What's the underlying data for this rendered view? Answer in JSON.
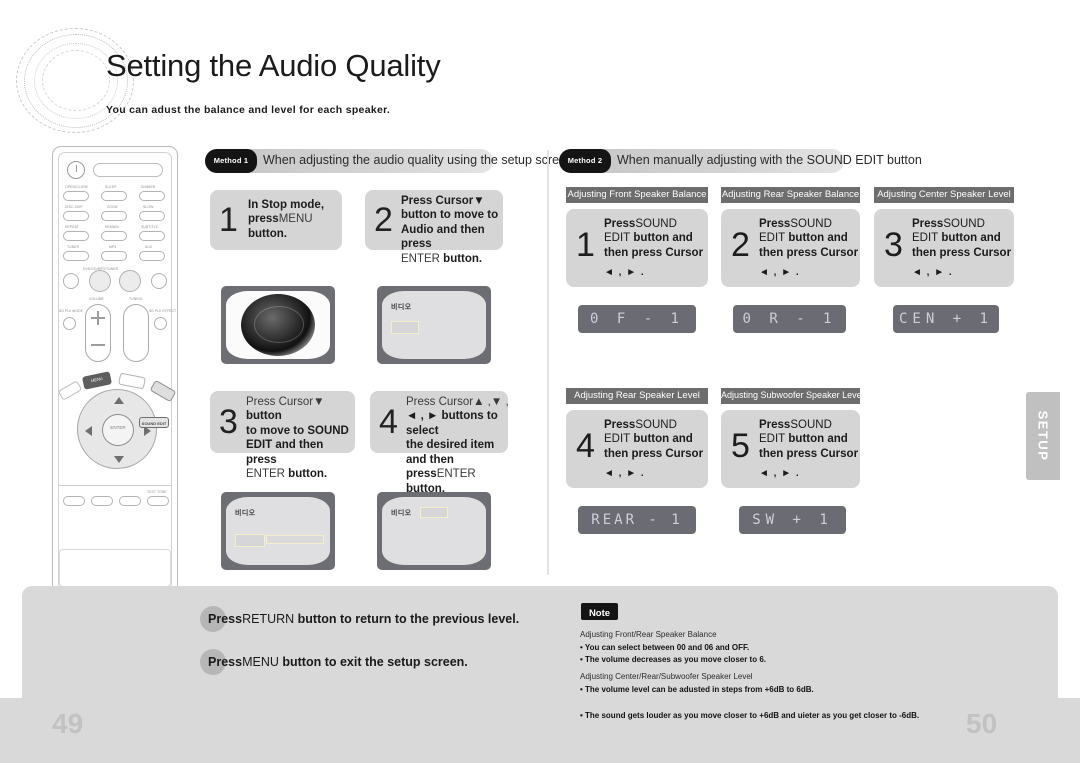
{
  "page": {
    "title": "Setting the Audio Quality",
    "subtitle": "You can adust the balance and level for each speaker.",
    "page_number_left": "49",
    "page_number_right": "50",
    "side_tab": "SETUP"
  },
  "method1": {
    "tag": "Method 1",
    "heading": "When adjusting the audio quality using the setup screen",
    "steps": [
      {
        "num": "1",
        "line1_b": "In Stop mode,",
        "line2_b": "press",
        "line2_l": "MENU",
        "line3_b": "button.",
        "line4_b": "",
        "line4_l": ""
      },
      {
        "num": "2",
        "line1_b": "Press Cursor▼",
        "line2_b": "button to move to",
        "line3_b": "Audio and then press",
        "line4_l": "ENTER",
        "line4_b": " button."
      },
      {
        "num": "3",
        "line1_l": "Press Cursor▼",
        "line1_b": " button",
        "line2_b": "to move to SOUND",
        "line3_b": "EDIT and then press",
        "line4_l": "ENTER",
        "line4_b": " button."
      },
      {
        "num": "4",
        "line1_l": "Press Cursor▲ ,▼ ,",
        "line2_b": "◄ , ► buttons to select",
        "line3_b": "the desired item and then",
        "line4_b": "press",
        "line4_l": "ENTER",
        "line4_b2": " button."
      }
    ],
    "screens": [
      {
        "label": "",
        "kind": "speaker"
      },
      {
        "label": "비디오",
        "kind": "menu-plain"
      },
      {
        "label": "비디오",
        "kind": "menu-bar"
      },
      {
        "label": "비디오",
        "kind": "menu-inline"
      }
    ]
  },
  "method2": {
    "tag": "Method 2",
    "heading": "When manually adjusting with the SOUND EDIT button",
    "panels": [
      {
        "header": "Adjusting Front Speaker Balance",
        "num": "1",
        "l1_b": "Press",
        "l1_l": "SOUND",
        "l2_l": "EDIT",
        "l2_b": " button and",
        "l3_b": "then press Cursor",
        "cursor": "◄ , ► .",
        "lcd": "0 F - 1"
      },
      {
        "header": "Adjusting Rear Speaker Balance",
        "num": "2",
        "l1_b": "Press",
        "l1_l": "SOUND",
        "l2_l": "EDIT",
        "l2_b": " button and",
        "l3_b": "then press Cursor",
        "cursor": "◄ , ► .",
        "lcd": "0 R - 1"
      },
      {
        "header": "Adjusting Center Speaker Level",
        "num": "3",
        "l1_b": "Press",
        "l1_l": "SOUND",
        "l2_l": "EDIT",
        "l2_b": " button and",
        "l3_b": "then press Cursor",
        "cursor": "◄ , ► .",
        "lcd": "CEN + 1"
      },
      {
        "header": "Adjusting Rear Speaker Level",
        "num": "4",
        "l1_b": "Press",
        "l1_l": "SOUND",
        "l2_l": "EDIT",
        "l2_b": " button and",
        "l3_b": "then press Cursor",
        "cursor": "◄ , ► .",
        "lcd": "REAR - 1"
      },
      {
        "header": "Adjusting Subwoofer Speaker Level",
        "num": "5",
        "l1_b": "Press",
        "l1_l": "SOUND",
        "l2_l": "EDIT",
        "l2_b": " button and",
        "l3_b": "then press Cursor",
        "cursor": "◄ , ► .",
        "lcd": "SW + 1"
      }
    ]
  },
  "footer": {
    "bullets": [
      {
        "b1": "Press",
        "l1": "RETURN",
        "b2": " button to return to the previous level."
      },
      {
        "b1": "Press",
        "l1": "MENU",
        "b2": " button to exit the setup screen."
      }
    ],
    "note_label": "Note",
    "note_groups": [
      {
        "head": "Adjusting Front/Rear Speaker Balance",
        "items": [
          "• You can select between 00 and 06 and OFF.",
          "• The volume decreases as you move closer to 6."
        ]
      },
      {
        "head": "Adjusting Center/Rear/Subwoofer Speaker Level",
        "items": [
          "• The volume level can be adusted in steps from +6dB to 6dB.",
          "• The sound gets louder as you move closer to +6dB and uieter as you get closer to -6dB."
        ]
      }
    ]
  },
  "remote": {
    "power_label": "",
    "labels": [
      "OPEN/CLOSE",
      "SLEEP",
      "DIMMER",
      "DISC SKIP",
      "ZOOM",
      "SLOW",
      "REPEAT",
      "REMAIN",
      "SUBTITLE",
      "TUNER",
      "MP3",
      "AUX",
      "DVD RECEIVER/TUNER",
      "VOLUME",
      "TUNING",
      "SD PLII MODE",
      "SD PLII EFFECT",
      "MENU",
      "RDS",
      "SOUND EDIT",
      "TEST TONE"
    ],
    "enter_label": "ENTER",
    "menu_label": "MENU",
    "sound_edit_label": "SOUND EDIT"
  }
}
